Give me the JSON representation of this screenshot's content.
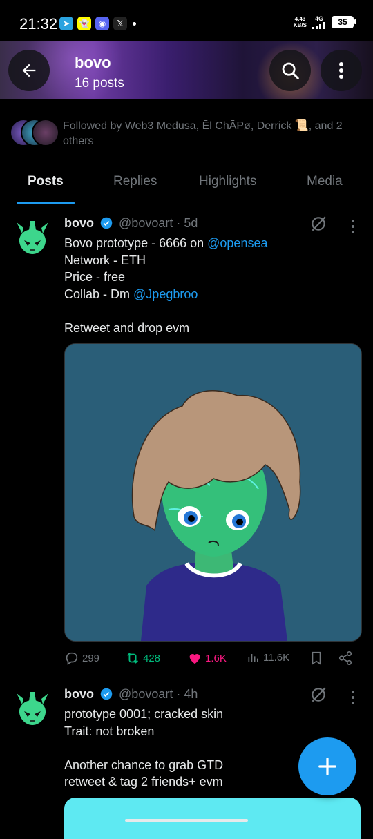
{
  "status_bar": {
    "time": "21:32",
    "net_speed_top": "4.43",
    "net_speed_bottom": "KB/S",
    "network": "4G",
    "battery": "35"
  },
  "header": {
    "name": "bovo",
    "post_count": "16 posts"
  },
  "followed_by": {
    "text": "Followed by Web3 Medusa, Ēl ChĀPø, Derrick 📜, and 2 others"
  },
  "tabs": [
    "Posts",
    "Replies",
    "Highlights",
    "Media"
  ],
  "tweets": [
    {
      "name": "bovo",
      "handle": "@bovoart",
      "separator": "·",
      "time": "5d",
      "line1_prefix": "Bovo prototype - 6666 on ",
      "line1_mention": "@opensea",
      "line2": "Network - ETH",
      "line3": "Price - free",
      "line4_prefix": "Collab - Dm ",
      "line4_mention": "@Jpegbroo",
      "line5": "Retweet and drop evm",
      "replies": "299",
      "reposts": "428",
      "likes": "1.6K",
      "views": "11.6K"
    },
    {
      "name": "bovo",
      "handle": "@bovoart",
      "separator": "·",
      "time": "4h",
      "line1": "prototype 0001; cracked skin",
      "line2": "Trait: not broken",
      "line3": "Another chance to grab GTD",
      "line4": "retweet & tag 2 friends+ evm"
    }
  ],
  "colors": {
    "accent": "#1d9bf0",
    "repost": "#00ba7c",
    "like": "#f91880",
    "muted": "#71767b"
  }
}
